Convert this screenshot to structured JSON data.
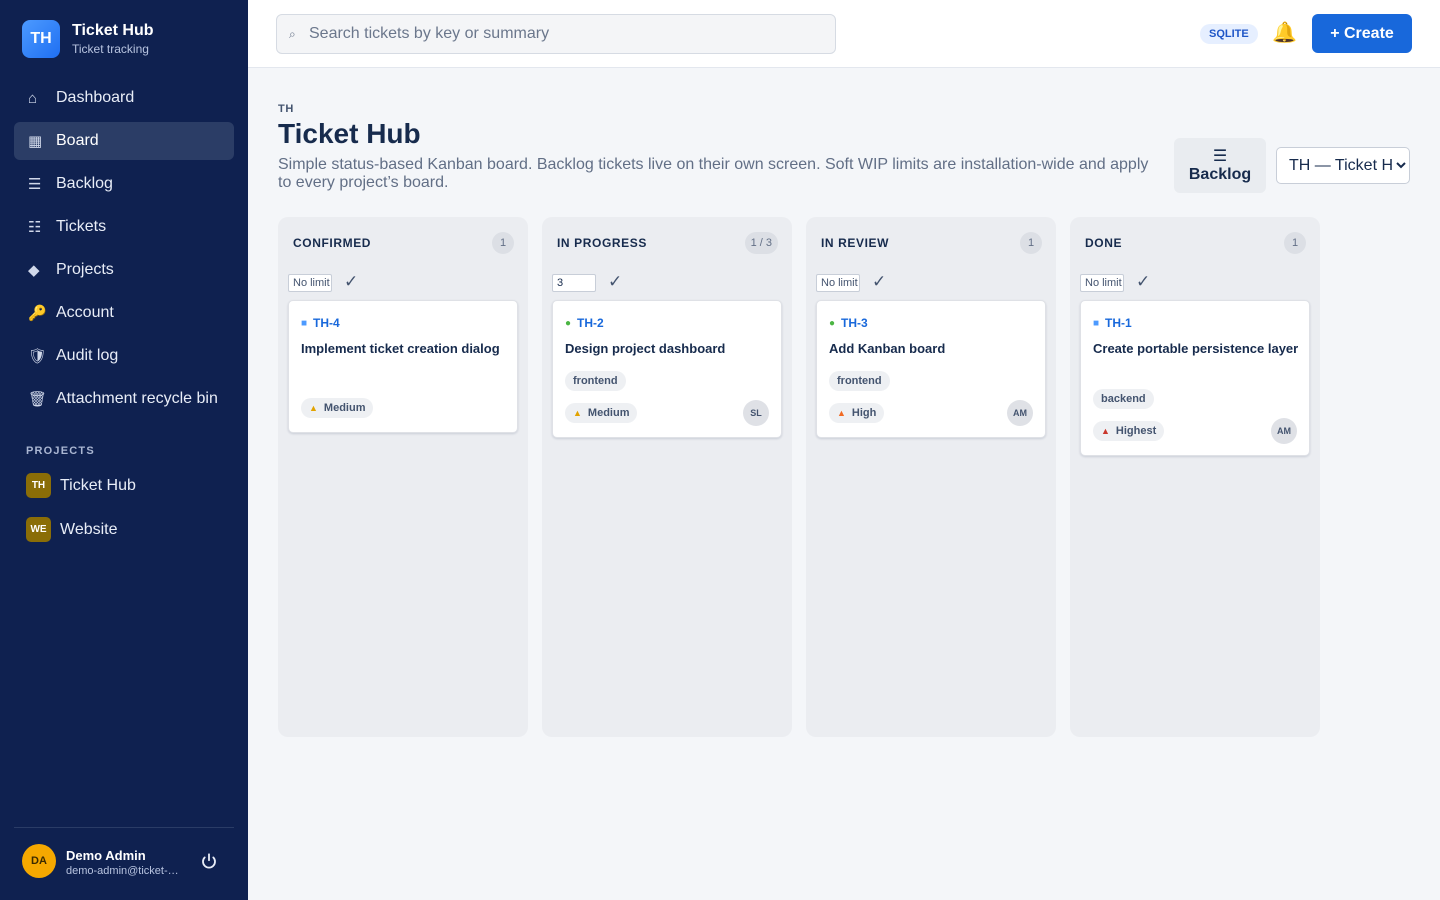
{
  "brand": {
    "logo": "TH",
    "title": "Ticket Hub",
    "subtitle": "Ticket tracking"
  },
  "nav": [
    {
      "label": "Dashboard",
      "icon": "⌂",
      "icon_name": "home-icon",
      "active": false
    },
    {
      "label": "Board",
      "icon": "▦",
      "icon_name": "board-icon",
      "active": true
    },
    {
      "label": "Backlog",
      "icon": "☰",
      "icon_name": "list-icon",
      "active": false
    },
    {
      "label": "Tickets",
      "icon": "☷",
      "icon_name": "tickets-icon",
      "active": false
    },
    {
      "label": "Projects",
      "icon": "◆",
      "icon_name": "projects-icon",
      "active": false
    },
    {
      "label": "Account",
      "icon": "🔑",
      "icon_name": "key-icon",
      "active": false
    },
    {
      "label": "Audit log",
      "icon": "🛡",
      "icon_name": "shield-icon",
      "active": false
    },
    {
      "label": "Attachment recycle bin",
      "icon": "🗑",
      "icon_name": "trash-icon",
      "active": false
    }
  ],
  "projects_heading": "PROJECTS",
  "projects": [
    {
      "badge": "TH",
      "name": "Ticket Hub"
    },
    {
      "badge": "WE",
      "name": "Website"
    }
  ],
  "user": {
    "initials": "DA",
    "name": "Demo Admin",
    "email": "demo-admin@ticket-hub.local"
  },
  "topbar": {
    "search_placeholder": "Search tickets by key or summary",
    "db_badge": "SQLITE",
    "create_label": "+ Create"
  },
  "page": {
    "key": "TH",
    "title": "Ticket Hub",
    "description": "Simple status-based Kanban board. Backlog tickets live on their own screen. Soft WIP limits are installation-wide and apply to every project’s board.",
    "backlog_icon": "☰",
    "backlog_label": "Backlog",
    "project_select": "TH — Ticket Hub"
  },
  "colors": {
    "sidebar": "#0f2150",
    "accent": "#1868db",
    "story": "#4c9aff",
    "task": "#4bb543",
    "medium": "#e2a300",
    "high": "#f06a24",
    "highest": "#c9372c"
  },
  "columns": [
    {
      "title": "CONFIRMED",
      "count": "1",
      "wip_value": "",
      "wip_placeholder": "No limit",
      "card": {
        "key": "TH-4",
        "type_icon": "■",
        "type_color": "#4c9aff",
        "summary": "Implement ticket creation dialog",
        "label": "",
        "priority": "Medium",
        "priority_icon": "▲",
        "priority_color": "#e2a300",
        "assignee": ""
      }
    },
    {
      "title": "IN PROGRESS",
      "count": "1 / 3",
      "wip_value": "3",
      "wip_placeholder": "No limit",
      "card": {
        "key": "TH-2",
        "type_icon": "●",
        "type_color": "#4bb543",
        "summary": "Design project dashboard",
        "label": "frontend",
        "priority": "Medium",
        "priority_icon": "▲",
        "priority_color": "#e2a300",
        "assignee": "SL"
      }
    },
    {
      "title": "IN REVIEW",
      "count": "1",
      "wip_value": "",
      "wip_placeholder": "No limit",
      "card": {
        "key": "TH-3",
        "type_icon": "●",
        "type_color": "#4bb543",
        "summary": "Add Kanban board",
        "label": "frontend",
        "priority": "High",
        "priority_icon": "▲",
        "priority_color": "#f06a24",
        "assignee": "AM"
      }
    },
    {
      "title": "DONE",
      "count": "1",
      "wip_value": "",
      "wip_placeholder": "No limit",
      "card": {
        "key": "TH-1",
        "type_icon": "■",
        "type_color": "#4c9aff",
        "summary": "Create portable persistence layer",
        "label": "backend",
        "priority": "Highest",
        "priority_icon": "▲",
        "priority_color": "#c9372c",
        "assignee": "AM"
      }
    }
  ]
}
